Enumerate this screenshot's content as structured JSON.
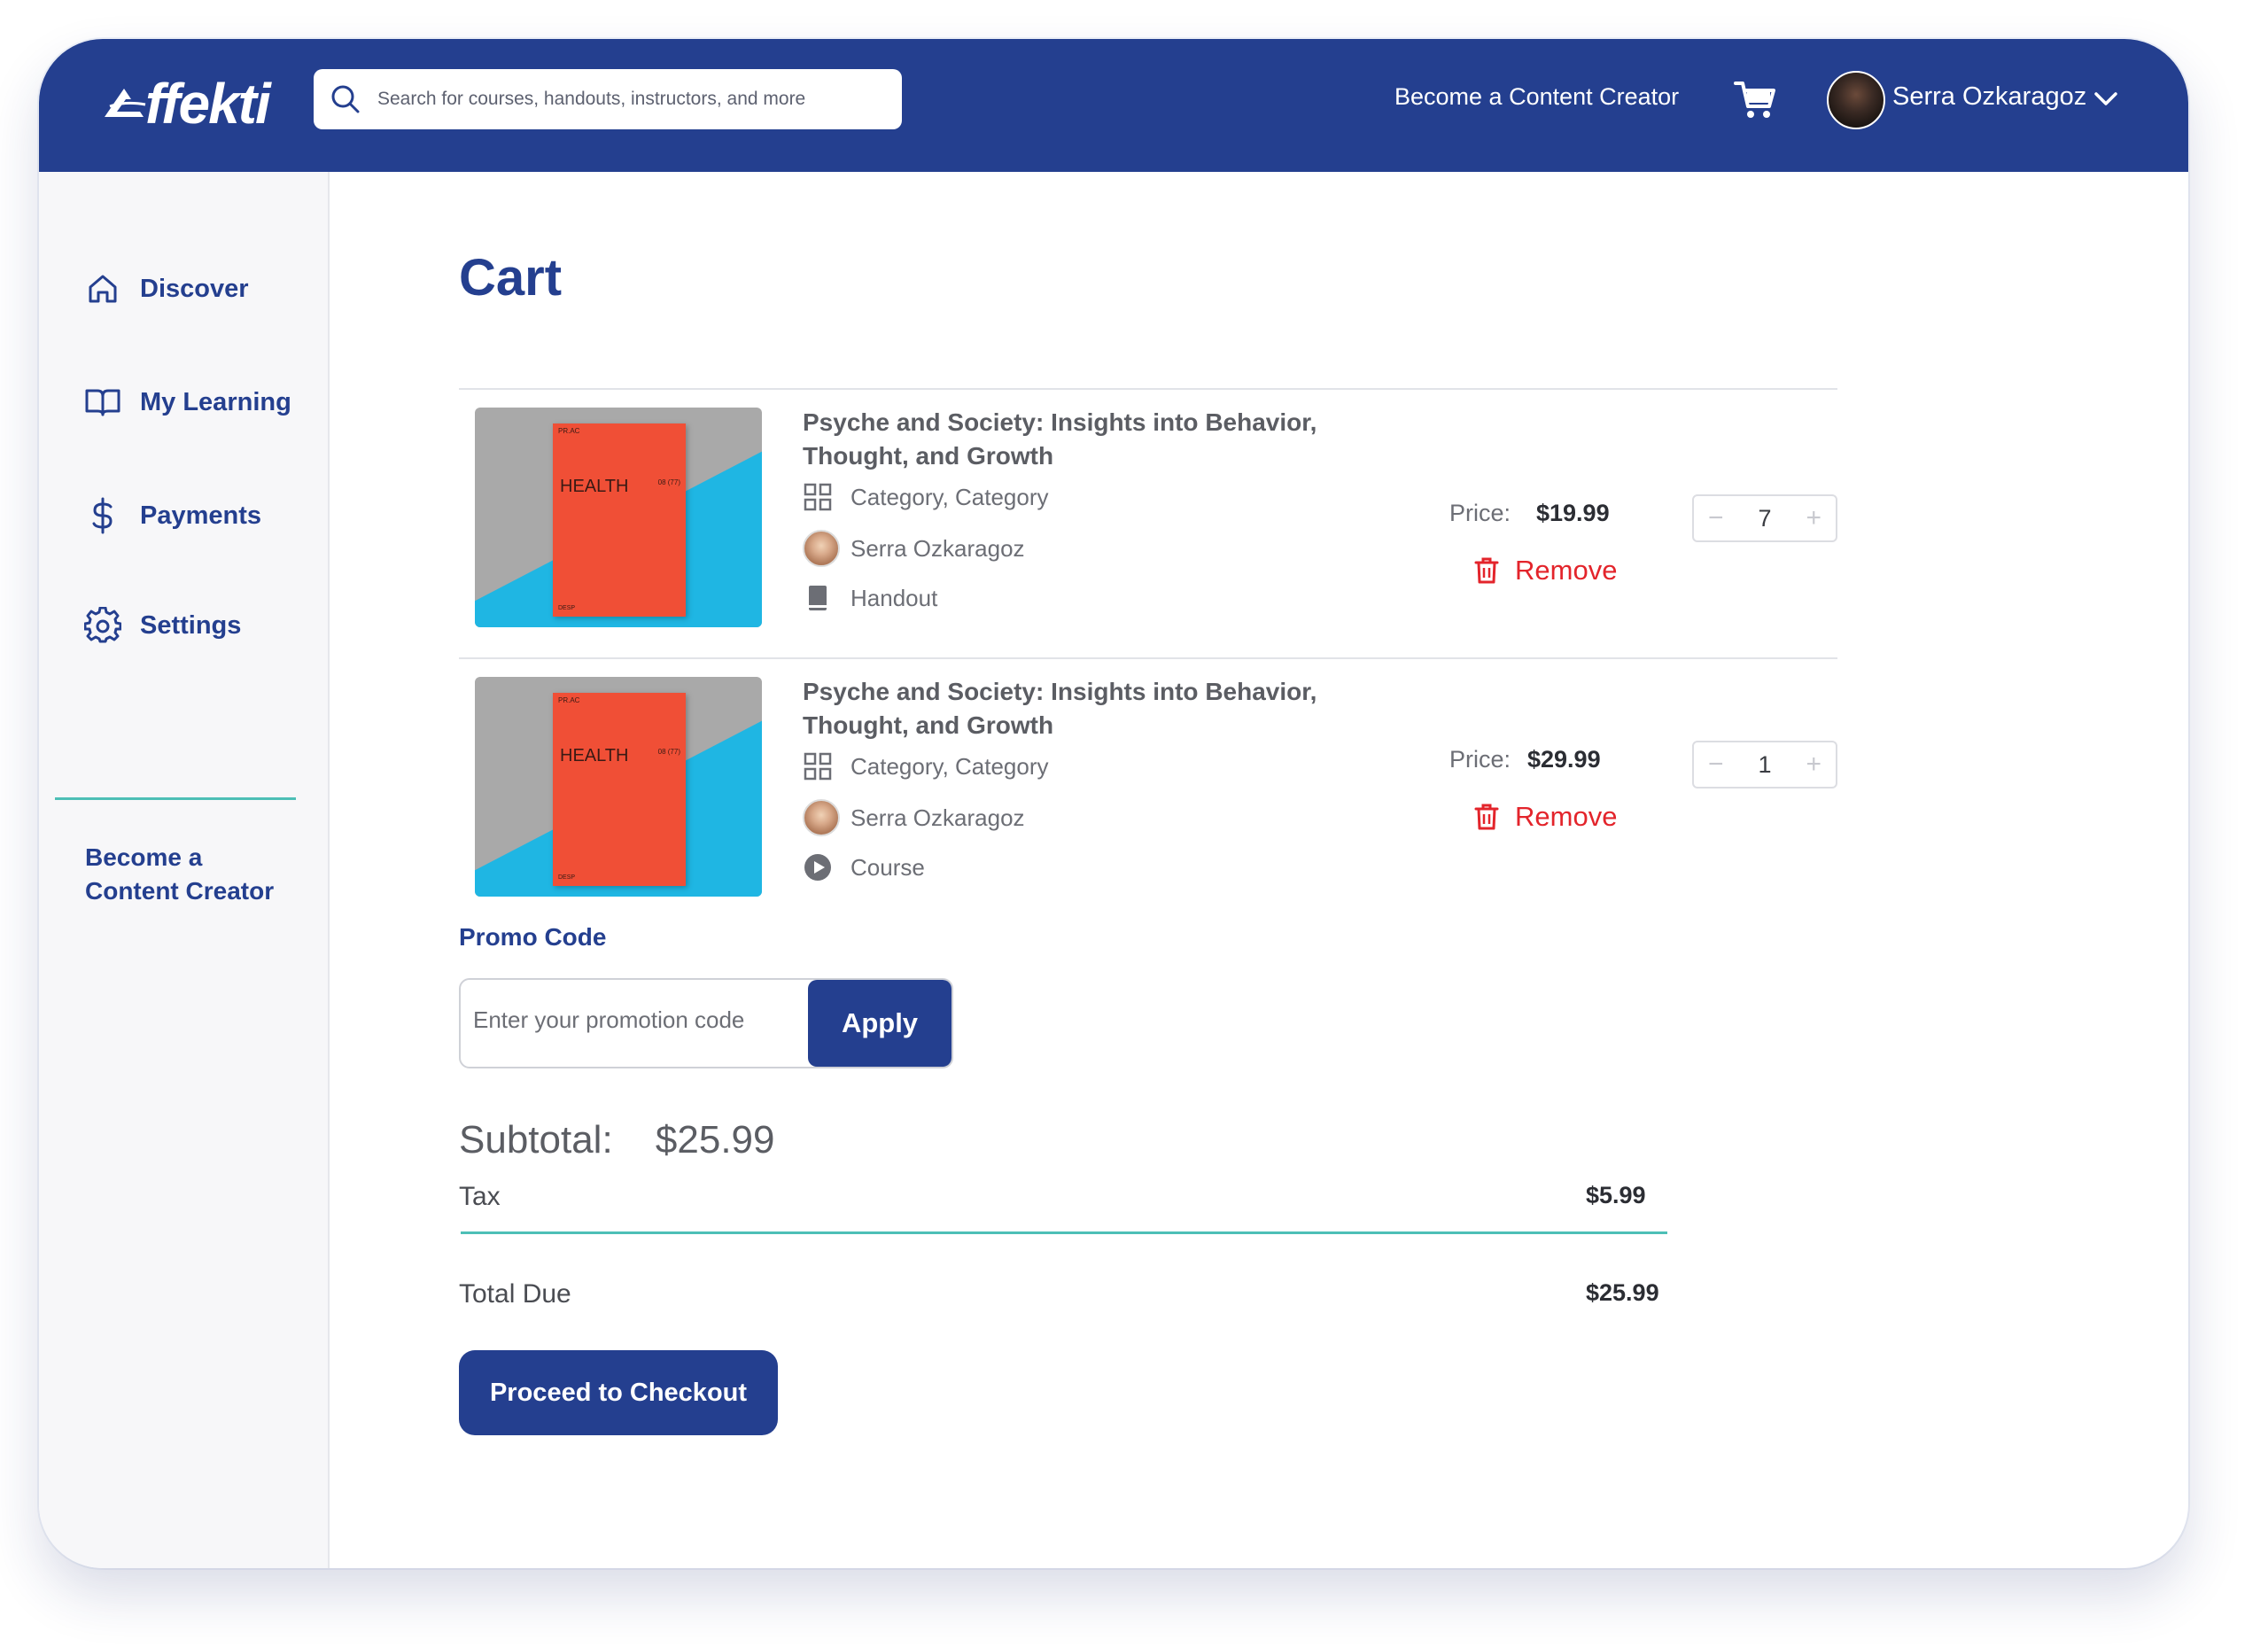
{
  "brand": {
    "logo_text": "ffekti"
  },
  "header": {
    "search_placeholder": "Search for courses, handouts, instructors, and more",
    "become_creator": "Become a Content Creator",
    "user_name": "Serra Ozkaragoz"
  },
  "sidebar": {
    "items": [
      {
        "label": "Discover",
        "icon": "home-icon"
      },
      {
        "label": "My Learning",
        "icon": "book-open-icon"
      },
      {
        "label": "Payments",
        "icon": "dollar-icon"
      },
      {
        "label": "Settings",
        "icon": "gear-icon"
      }
    ],
    "become_creator": "Become a Content Creator"
  },
  "cart": {
    "title": "Cart",
    "price_label": "Price:",
    "remove_label": "Remove",
    "items": [
      {
        "title": "Psyche and Society: Insights into Behavior, Thought, and Growth",
        "categories": "Category, Category",
        "author": "Serra Ozkaragoz",
        "type": "Handout",
        "price": "$19.99",
        "quantity": "7",
        "cover_text": "HEALTH"
      },
      {
        "title": "Psyche and Society: Insights into Behavior, Thought, and Growth",
        "categories": "Category, Category",
        "author": "Serra Ozkaragoz",
        "type": "Course",
        "price": "$29.99",
        "quantity": "1",
        "cover_text": "HEALTH"
      }
    ]
  },
  "promo": {
    "heading": "Promo Code",
    "placeholder": "Enter your promotion code",
    "apply_label": "Apply"
  },
  "summary": {
    "subtotal_label": "Subtotal:",
    "subtotal_value": "$25.99",
    "tax_label": "Tax",
    "tax_value": "$5.99",
    "total_label": "Total Due",
    "total_value": "$25.99",
    "checkout_label": "Proceed to Checkout"
  },
  "colors": {
    "brand_navy": "#243f8f",
    "accent_teal": "#4dbfb6",
    "remove_red": "#e3242b"
  }
}
